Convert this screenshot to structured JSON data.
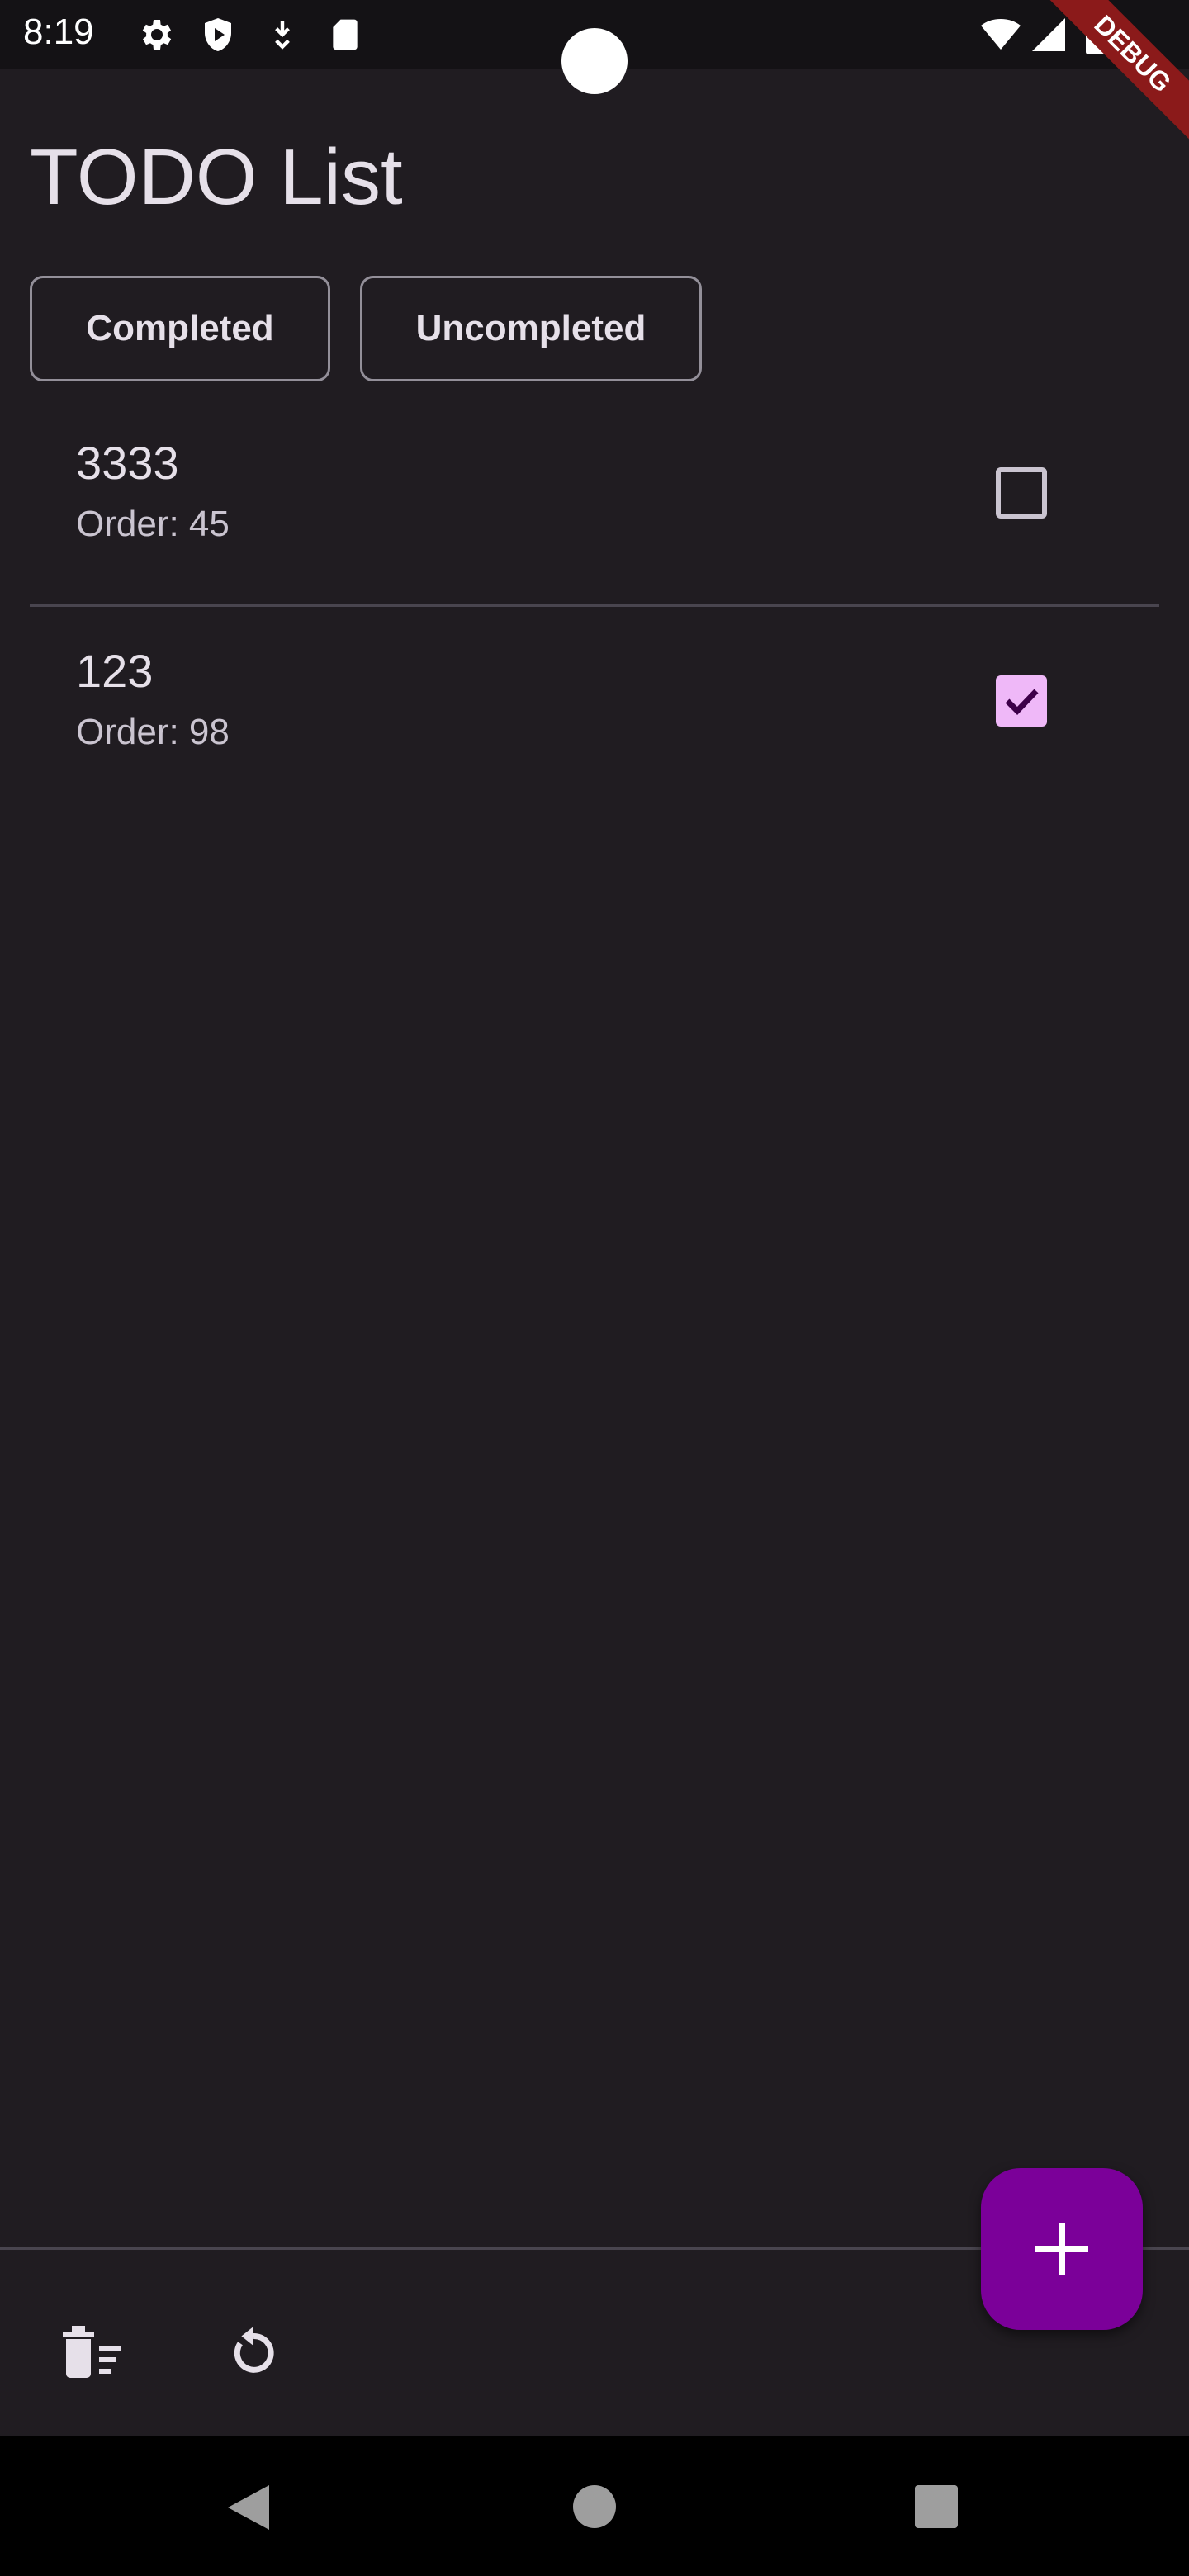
{
  "status_bar": {
    "time": "8:19",
    "icons": [
      "gear-icon",
      "shield-play-icon",
      "download-icon",
      "sd-card-icon",
      "wifi-icon",
      "signal-icon",
      "battery-icon"
    ]
  },
  "debug_banner": {
    "label": "DEBUG"
  },
  "app": {
    "title": "TODO List"
  },
  "filters": {
    "completed_label": "Completed",
    "uncompleted_label": "Uncompleted"
  },
  "todos": [
    {
      "title": "3333",
      "order_text": "Order: 45",
      "completed": false
    },
    {
      "title": "123",
      "order_text": "Order: 98",
      "completed": true
    }
  ],
  "bottom_bar": {
    "icons": [
      "delete-sweep-icon",
      "refresh-icon"
    ]
  },
  "fab": {
    "icon": "plus-icon"
  },
  "nav_bar": {
    "icons": [
      "back-icon",
      "home-icon",
      "recents-icon"
    ]
  },
  "colors": {
    "background": "#201c21",
    "fab": "#7b0099",
    "checkbox_checked": "#efb8f8",
    "debug_ribbon": "#8b1a1a"
  }
}
